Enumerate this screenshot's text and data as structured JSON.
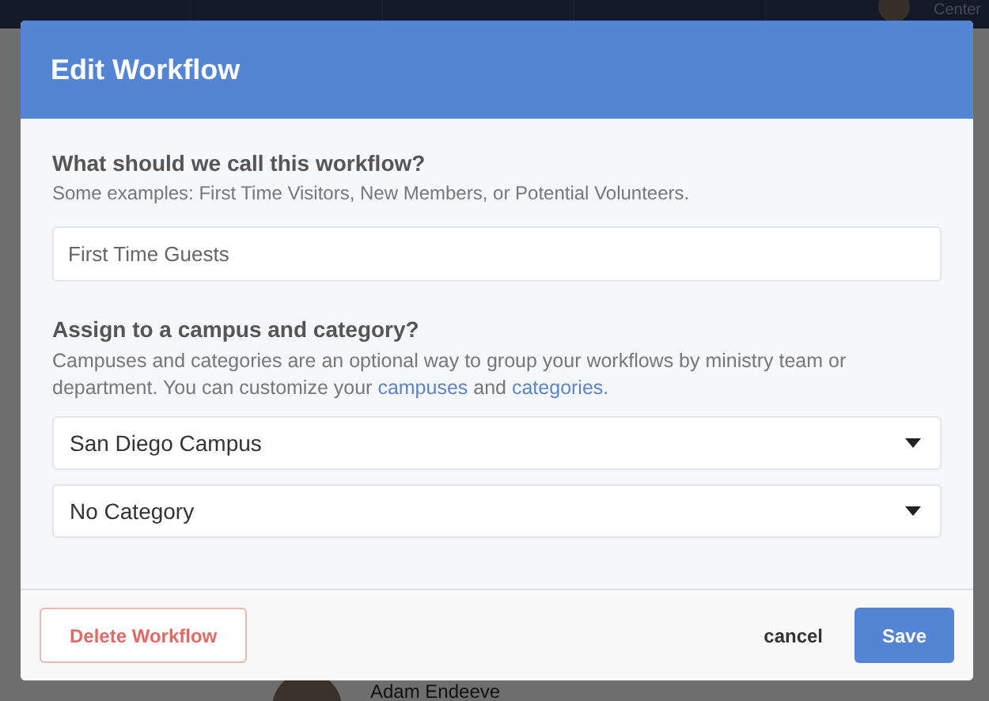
{
  "background": {
    "top_bar": {
      "user_label": "Center"
    },
    "profile": {
      "name": "Adam Endeeve"
    }
  },
  "dialog": {
    "title": "Edit Workflow",
    "name_section": {
      "heading": "What should we call this workflow?",
      "hint": "Some examples: First Time Visitors, New Members, or Potential Volunteers.",
      "value": "First Time Guests"
    },
    "assign_section": {
      "heading": "Assign to a campus and category?",
      "description": "Campuses and categories are an optional way to group your workflows by ministry team or department. You can customize your",
      "link_1": "campuses",
      "joiner": "and",
      "link_2": "categories."
    },
    "selects": [
      {
        "value": "San Diego Campus"
      },
      {
        "value": "No Category"
      }
    ],
    "footer": {
      "delete_button": "Delete Workflow",
      "cancel_button": "cancel",
      "save_button": "Save"
    }
  }
}
